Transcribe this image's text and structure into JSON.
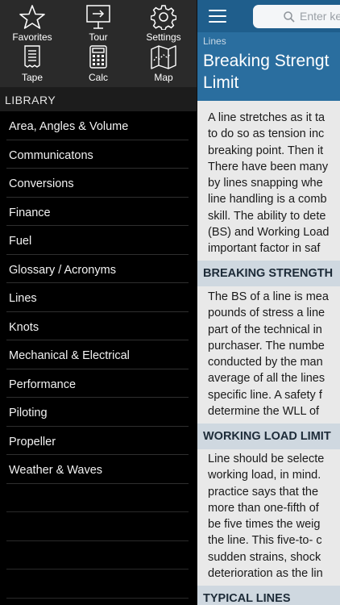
{
  "toolbar": {
    "items": [
      {
        "label": "Favorites",
        "icon": "star-icon"
      },
      {
        "label": "Tour",
        "icon": "tour-icon"
      },
      {
        "label": "Settings",
        "icon": "gear-icon"
      },
      {
        "label": "Tape",
        "icon": "tape-icon"
      },
      {
        "label": "Calc",
        "icon": "calculator-icon"
      },
      {
        "label": "Map",
        "icon": "map-icon"
      }
    ]
  },
  "library": {
    "header": "LIBRARY",
    "items": [
      "Area, Angles & Volume",
      "Communicatons",
      "Conversions",
      "Finance",
      "Fuel",
      "Glossary / Acronyms",
      "Lines",
      "Knots",
      "Mechanical & Electrical",
      "Performance",
      "Piloting",
      "Propeller",
      "Weather & Waves"
    ]
  },
  "search": {
    "placeholder": "Enter ke"
  },
  "article": {
    "category": "Lines",
    "title_line1": "Breaking Strengt",
    "title_line2": "Limit",
    "intro": [
      "A line stretches as it ta",
      "to do so as tension inc",
      "breaking point. Then it",
      "There have been many",
      "by lines snapping whe",
      "line handling is a comb",
      "skill. The ability to dete",
      "(BS) and Working Load",
      "important factor in saf"
    ],
    "section1_head": "BREAKING STRENGTH",
    "section1": [
      "The BS of a line is mea",
      "pounds of stress a line",
      "part of the technical in",
      "purchaser. The numbe",
      "conducted by the man",
      "average of all the lines",
      "specific line. A safety f",
      "determine the WLL of"
    ],
    "section2_head": "WORKING LOAD LIMIT",
    "section2": [
      "Line should be selecte",
      "working load, in mind.",
      "practice says that the",
      "more than one-fifth of",
      "be five times the weig",
      "the line. This five-to- c",
      "sudden strains, shock",
      "deterioration as the lin"
    ],
    "section3_head": "TYPICAL LINES"
  },
  "colors": {
    "topbar": "#1f5e8c",
    "title_block": "#2a6e9f",
    "section_head": "#cfd8e0"
  }
}
